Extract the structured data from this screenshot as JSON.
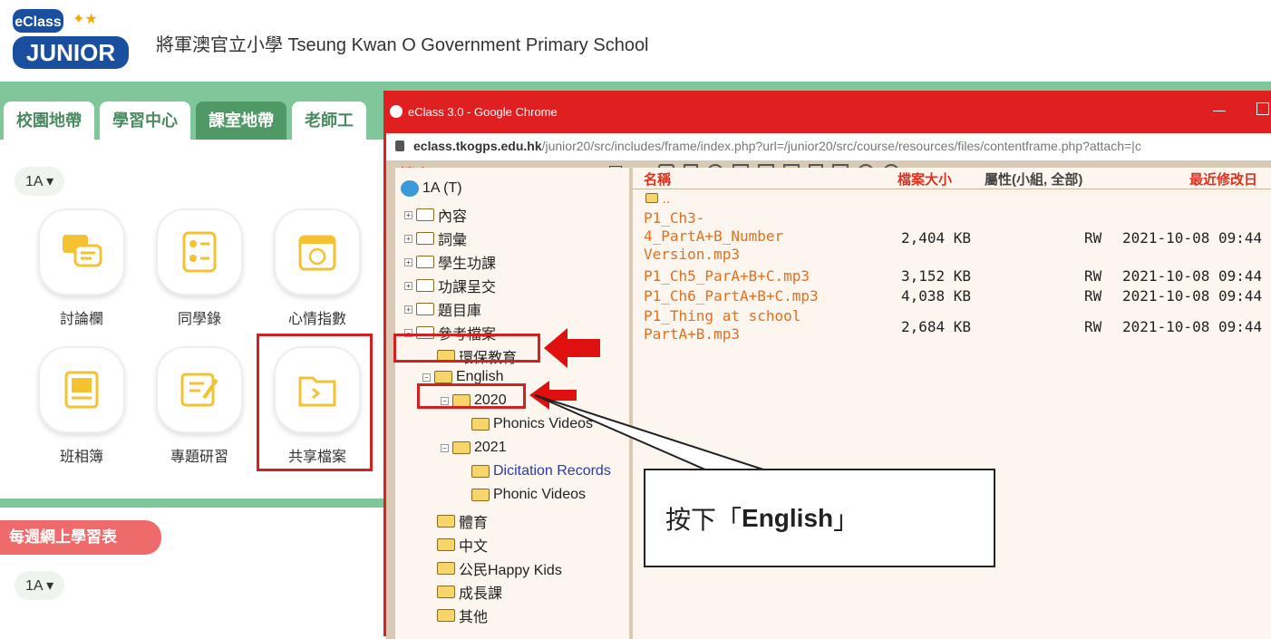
{
  "header": {
    "school_name": "將軍澳官立小學 Tseung Kwan O Government Primary School",
    "logo_top": "eClass",
    "logo_bottom": "JUNIOR"
  },
  "tabs": [
    {
      "label": "校園地帶"
    },
    {
      "label": "學習中心"
    },
    {
      "label": "課室地帶",
      "active": true
    },
    {
      "label": "老師工"
    }
  ],
  "class_selector": "1A ▾",
  "apps": [
    {
      "label": "討論欄",
      "icon": "chat-icon"
    },
    {
      "label": "同學錄",
      "icon": "contacts-icon"
    },
    {
      "label": "心情指數",
      "icon": "mood-calendar-icon"
    },
    {
      "label": "班相簿",
      "icon": "photo-album-icon"
    },
    {
      "label": "專題研習",
      "icon": "project-icon"
    },
    {
      "label": "共享檔案",
      "icon": "shared-folder-icon"
    }
  ],
  "weekly": {
    "title": "每週網上學習表",
    "class_selector": "1A ▾"
  },
  "popup": {
    "window_title": "eClass 3.0 - Google Chrome",
    "minimize": "—",
    "url_domain": "eclass.tkogps.edu.hk",
    "url_path": "/junior20/src/includes/frame/index.php?url=/junior20/src/course/resources/files/contentframe.php?attach=|c",
    "tree_header": "檔案",
    "columns": {
      "name": "名稱",
      "size": "檔案大小",
      "attr": "屬性(小組, 全部)",
      "modified": "最近修改日"
    },
    "tree": [
      {
        "label": "1A (T)"
      },
      {
        "label": "內容"
      },
      {
        "label": "詞彙"
      },
      {
        "label": "學生功課"
      },
      {
        "label": "功課呈交"
      },
      {
        "label": "題目庫"
      },
      {
        "label": "參考檔案"
      },
      {
        "label": "環保教育"
      },
      {
        "label": "English"
      },
      {
        "label": "2020"
      },
      {
        "label": "Phonics Videos"
      },
      {
        "label": "2021"
      },
      {
        "label": "Dicitation Records"
      },
      {
        "label": "Phonic Videos"
      },
      {
        "label": "體育"
      },
      {
        "label": "中文"
      },
      {
        "label": "公民Happy Kids"
      },
      {
        "label": "成長課"
      },
      {
        "label": "其他"
      }
    ],
    "up_dir": "..",
    "files": [
      {
        "name1": "P1_Ch3-",
        "name2": "4_PartA+B_Number",
        "name3": "Version.mp3",
        "size": "2,404 KB",
        "attr": "RW",
        "date": "2021-10-08 09:44"
      },
      {
        "name1": "P1_Ch5_ParA+B+C.mp3",
        "size": "3,152 KB",
        "attr": "RW",
        "date": "2021-10-08 09:44"
      },
      {
        "name1": "P1_Ch6_PartA+B+C.mp3",
        "size": "4,038 KB",
        "attr": "RW",
        "date": "2021-10-08 09:44"
      },
      {
        "name1": "P1_Thing at school",
        "name2": "PartA+B.mp3",
        "size": "2,684 KB",
        "attr": "RW",
        "date": "2021-10-08 09:44"
      }
    ]
  },
  "callout": {
    "prefix": "按下「",
    "bold": "English",
    "suffix": "」"
  },
  "colors": {
    "accent_green": "#4f9966",
    "red": "#e02020",
    "orange": "#e07020"
  }
}
